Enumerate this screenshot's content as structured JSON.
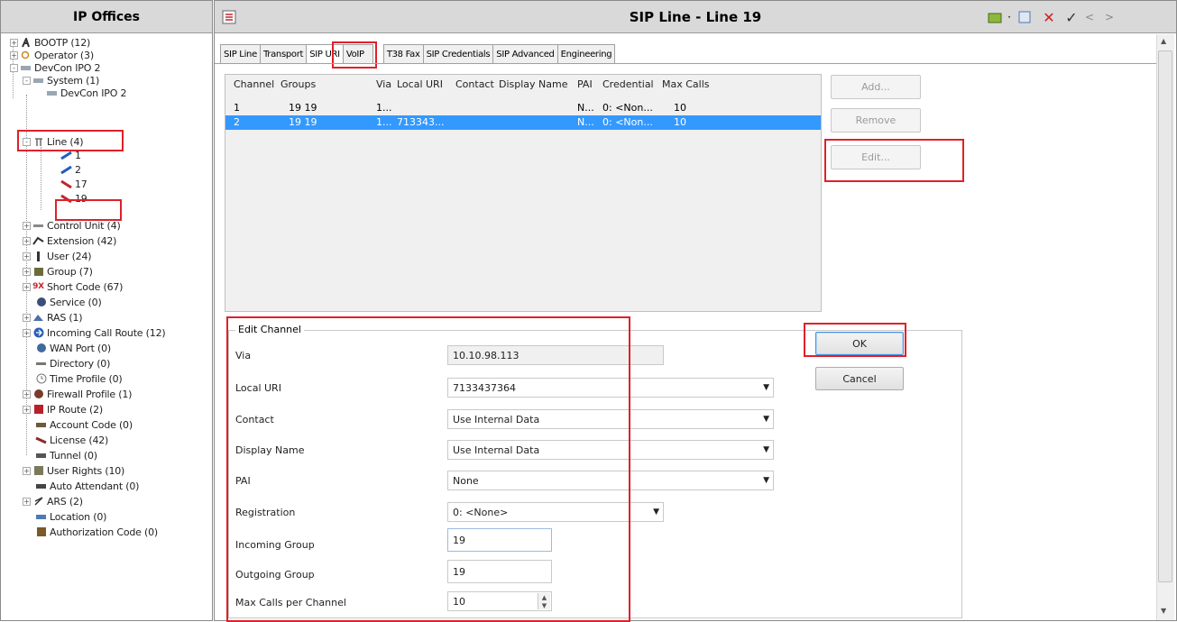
{
  "left_pane": {
    "title": "IP Offices",
    "tree": [
      {
        "label": "BOOTP (12)",
        "icon": "bootp-icon",
        "expander": "+"
      },
      {
        "label": "Operator (3)",
        "icon": "operator-icon",
        "expander": "+"
      },
      {
        "label": "DevCon IPO 2",
        "icon": "system-icon",
        "expander": "-"
      },
      {
        "label": "System (1)",
        "icon": "system-icon",
        "expander": "-"
      },
      {
        "label": "DevCon IPO 2",
        "icon": "system-icon",
        "expander": ""
      },
      {
        "label": "Line (4)",
        "icon": "line-icon",
        "expander": "-"
      },
      {
        "label": "1",
        "icon": "line-blue-icon",
        "expander": ""
      },
      {
        "label": "2",
        "icon": "line-blue-icon",
        "expander": ""
      },
      {
        "label": "17",
        "icon": "line-red-icon",
        "expander": ""
      },
      {
        "label": "19",
        "icon": "line-red-icon",
        "expander": ""
      },
      {
        "label": "Control Unit (4)",
        "icon": "control-unit-icon",
        "expander": "+"
      },
      {
        "label": "Extension (42)",
        "icon": "extension-icon",
        "expander": "+"
      },
      {
        "label": "User (24)",
        "icon": "user-icon",
        "expander": "+"
      },
      {
        "label": "Group (7)",
        "icon": "group-icon",
        "expander": "+"
      },
      {
        "label": "Short Code (67)",
        "icon": "short-code-icon",
        "expander": "+"
      },
      {
        "label": "Service (0)",
        "icon": "service-icon",
        "expander": ""
      },
      {
        "label": "RAS (1)",
        "icon": "ras-icon",
        "expander": "+"
      },
      {
        "label": "Incoming Call Route (12)",
        "icon": "incoming-call-route-icon",
        "expander": "+"
      },
      {
        "label": "WAN Port (0)",
        "icon": "wan-port-icon",
        "expander": ""
      },
      {
        "label": "Directory (0)",
        "icon": "directory-icon",
        "expander": ""
      },
      {
        "label": "Time Profile (0)",
        "icon": "time-profile-icon",
        "expander": ""
      },
      {
        "label": "Firewall Profile (1)",
        "icon": "firewall-icon",
        "expander": "+"
      },
      {
        "label": "IP Route (2)",
        "icon": "ip-route-icon",
        "expander": "+"
      },
      {
        "label": "Account Code (0)",
        "icon": "account-code-icon",
        "expander": ""
      },
      {
        "label": "License (42)",
        "icon": "license-icon",
        "expander": ""
      },
      {
        "label": "Tunnel (0)",
        "icon": "tunnel-icon",
        "expander": ""
      },
      {
        "label": "User Rights (10)",
        "icon": "user-rights-icon",
        "expander": "+"
      },
      {
        "label": "Auto Attendant (0)",
        "icon": "auto-attendant-icon",
        "expander": ""
      },
      {
        "label": "ARS (2)",
        "icon": "ars-icon",
        "expander": "+"
      },
      {
        "label": "Location (0)",
        "icon": "location-icon",
        "expander": ""
      },
      {
        "label": "Authorization Code (0)",
        "icon": "authorization-code-icon",
        "expander": ""
      }
    ]
  },
  "header": {
    "title": "SIP Line - Line 19"
  },
  "tabs": [
    {
      "label": "SIP Line"
    },
    {
      "label": "Transport"
    },
    {
      "label": "SIP URI",
      "active": true
    },
    {
      "label": "VoIP"
    },
    {
      "label": "T38 Fax"
    },
    {
      "label": "SIP Credentials"
    },
    {
      "label": "SIP Advanced"
    },
    {
      "label": "Engineering"
    }
  ],
  "grid": {
    "columns": [
      "Channel",
      "Groups",
      "Via",
      "Local URI",
      "Contact",
      "Display Name",
      "PAI",
      "Credential",
      "Max Calls"
    ],
    "rows": [
      {
        "channel": "1",
        "groups": "19  19",
        "via": "1...",
        "local_uri": "",
        "contact": "",
        "display_name": "",
        "pai": "N...",
        "credential": "0: <Non...",
        "max_calls": "10",
        "selected": false
      },
      {
        "channel": "2",
        "groups": "19  19",
        "via": "1...",
        "local_uri": "713343...",
        "contact": "",
        "display_name": "",
        "pai": "N...",
        "credential": "0: <Non...",
        "max_calls": "10",
        "selected": true
      }
    ]
  },
  "side_buttons": {
    "add": "Add...",
    "remove": "Remove",
    "edit": "Edit..."
  },
  "edit_channel": {
    "legend": "Edit Channel",
    "via_label": "Via",
    "via_value": "10.10.98.113",
    "local_uri_label": "Local URI",
    "local_uri_value": "7133437364",
    "contact_label": "Contact",
    "contact_value": "Use Internal Data",
    "display_name_label": "Display Name",
    "display_name_value": "Use Internal Data",
    "pai_label": "PAI",
    "pai_value": "None",
    "registration_label": "Registration",
    "registration_value": "0: <None>",
    "incoming_group_label": "Incoming Group",
    "incoming_group_value": "19",
    "outgoing_group_label": "Outgoing Group",
    "outgoing_group_value": "19",
    "max_calls_label": "Max Calls per Channel",
    "max_calls_value": "10"
  },
  "dialog_buttons": {
    "ok": "OK",
    "cancel": "Cancel"
  },
  "colors": {
    "highlight_red": "#e0202a",
    "selection_blue": "#3399ff",
    "title_gray": "#d9d9d9"
  }
}
